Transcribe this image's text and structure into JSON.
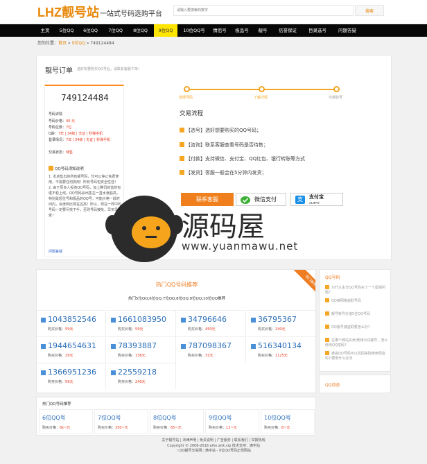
{
  "header": {
    "logo": "LHZ靓号站",
    "slogan": "一站式号码选购平台",
    "search_placeholder": "请输入要搜索的数字",
    "search_button": "搜索"
  },
  "nav": {
    "items": [
      "主页",
      "5位QQ",
      "6位QQ",
      "7位QQ",
      "8位QQ",
      "9位QQ",
      "10位QQ号",
      "情侣号",
      "极品号",
      "靓号",
      "信誉保证",
      "目录选号",
      "问题答疑"
    ],
    "active_index": 5
  },
  "breadcrumb": {
    "prefix": "您的位置：",
    "home": "首页",
    "sep": "»",
    "category": "9位QQ",
    "current": "749124484"
  },
  "order": {
    "title": "靓号订单",
    "subtitle": "选好所要购买QQ号后，请联系客服下单！",
    "qq_number": "749124484",
    "details_label": "号码详情",
    "price_label": "号码价格：",
    "price_value": "40 元",
    "digits_label": "号码位数：",
    "digits_value": "7位",
    "qq_age_label": "Q龄：",
    "qq_age_value": "7年 | 34级 | 无证 | 秒弹手机",
    "login_label": "登录情况：",
    "login_value": "7年 | 34级 | 无证 | 秒弹手机",
    "trade_label": "交易状态：",
    "trade_value": "待售",
    "notice_title": "QQ号码须知说明",
    "notice_text": "1. 本店售出的所有靓号码，均可以停止免费使用，不需要任何费用！所有号码包安全性佳！ 2. 由于原多人投资QQ号码，加上腾讯的监管有堪不稳上线，QQ号码会出售在一直水涨船高，特别是短位号和极品的QQ号，可能价格一段时间内，会涨到比现在还高！所以，现在一样中的号码一定要尽快下手，否则号码被抢，早买早享受！",
    "more_link": "问题答疑"
  },
  "steps": [
    "选择号码",
    "了解详情",
    "付款取号"
  ],
  "flow": {
    "title": "交易流程",
    "items": [
      "【选号】选好想要购买的QQ号码；",
      "【咨询】联系客服查看号码是否待售；",
      "【付款】支持微信、支付宝、QQ红包、银行转账等方式",
      "【发货】客服一般会在5分钟内发货；"
    ]
  },
  "buttons": {
    "contact": "联系客服",
    "wechat_pay": "微信支付",
    "alipay": "支付宝",
    "alipay_en": "ALIPAY"
  },
  "watermark": {
    "text": "源码屋",
    "url": "www.yuanmawu.net"
  },
  "hot": {
    "title": "热门QQ号码推荐",
    "subtitle": "热门5位QQ,6位QQ,7位QQ,8位QQ,9位QQ,10位QQ推荐",
    "ribbon": "热门推荐",
    "price_label": "购买价格：",
    "numbers": [
      {
        "num": "1043852546",
        "price": "59元"
      },
      {
        "num": "1661083950",
        "price": "59元"
      },
      {
        "num": "34796646",
        "price": "450元"
      },
      {
        "num": "36795367",
        "price": "240元"
      },
      {
        "num": "1944654631",
        "price": "29元"
      },
      {
        "num": "78393887",
        "price": "136元"
      },
      {
        "num": "787098367",
        "price": "31元"
      },
      {
        "num": "516340134",
        "price": "1125元"
      },
      {
        "num": "1366951236",
        "price": "59元"
      },
      {
        "num": "22559218",
        "price": "240元"
      }
    ]
  },
  "side": {
    "title": "QQ号码",
    "items": [
      "为什么生日QQ号码买了一个星期问题？",
      "QQ被网络盗取号码",
      "靓号帐号价值5位QQ号码",
      "QQ靓号被盗取要怎么办?",
      "在哪个网站买卖/使用/QQ靓号，怎么修改QQ密码?",
      "被盗QQ号码可以找回来取使用便宜吗?/要靠什么办法"
    ],
    "qqdt_title": "QQ动态"
  },
  "rec": {
    "title": "热门QQ号码推荐",
    "price_label": "购买价格：",
    "items": [
      {
        "name": "6位QQ号",
        "price": "6k~元"
      },
      {
        "name": "7位QQ号",
        "price": "350~元"
      },
      {
        "name": "8位QQ号",
        "price": "65~元"
      },
      {
        "name": "9位QQ号",
        "price": "13~元"
      },
      {
        "name": "10位QQ号",
        "price": "8~元"
      }
    ]
  },
  "footer": {
    "line1": "关于靓号站 | 法律声明 | 免责说明 | 广告服务 | 联系我们 | 举报热线",
    "line2": "Copyright © 2008-2018 aihn.aitk.vip 技术支持：满字站",
    "line3": "☆QQ靓号交易网☆满字站 - 9位QQ号码正规网站"
  },
  "colors": {
    "accent": "#ef7d22",
    "nav_bg": "#070707",
    "nav_active": "#ffe500",
    "link_blue": "#2a6db8"
  }
}
